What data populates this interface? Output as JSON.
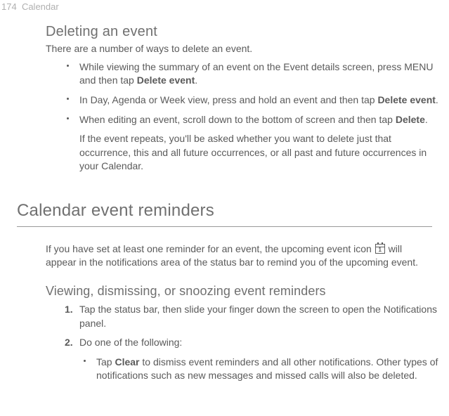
{
  "header": {
    "page_num": "174",
    "section": "Calendar"
  },
  "deleting": {
    "title": "Deleting an event",
    "intro": "There are a number of ways to delete an event.",
    "b1_a": "While viewing the summary of an event on the Event details screen, press MENU and then tap ",
    "b1_b": "Delete event",
    "b1_c": ".",
    "b2_a": "In Day, Agenda or Week view, press and hold an event and then tap ",
    "b2_b": "Delete event",
    "b2_c": ".",
    "b3_a": "When editing an event, scroll down to the bottom of screen and then tap ",
    "b3_b": "Delete",
    "b3_c": ".",
    "repeat": "If the event repeats, you'll be asked whether you want to delete just that occurrence, this and all future occurrences, or all past and future occurrences in your Calendar."
  },
  "reminders": {
    "title": "Calendar event reminders",
    "body_a": "If you have set at least one reminder for an event, the upcoming event icon ",
    "body_b": " will appear in the notifications area of the status bar to remind you of the upcoming event.",
    "sub": "Viewing, dismissing, or snoozing event reminders",
    "n1": "Tap the status bar, then slide your finger down the screen to open the Notifications panel.",
    "n2": "Do one of the following:",
    "nb_a": "Tap ",
    "nb_b": "Clear",
    "nb_c": " to dismiss event reminders and all other notifications. Other types of notifications such as new messages and missed calls will also be deleted."
  }
}
